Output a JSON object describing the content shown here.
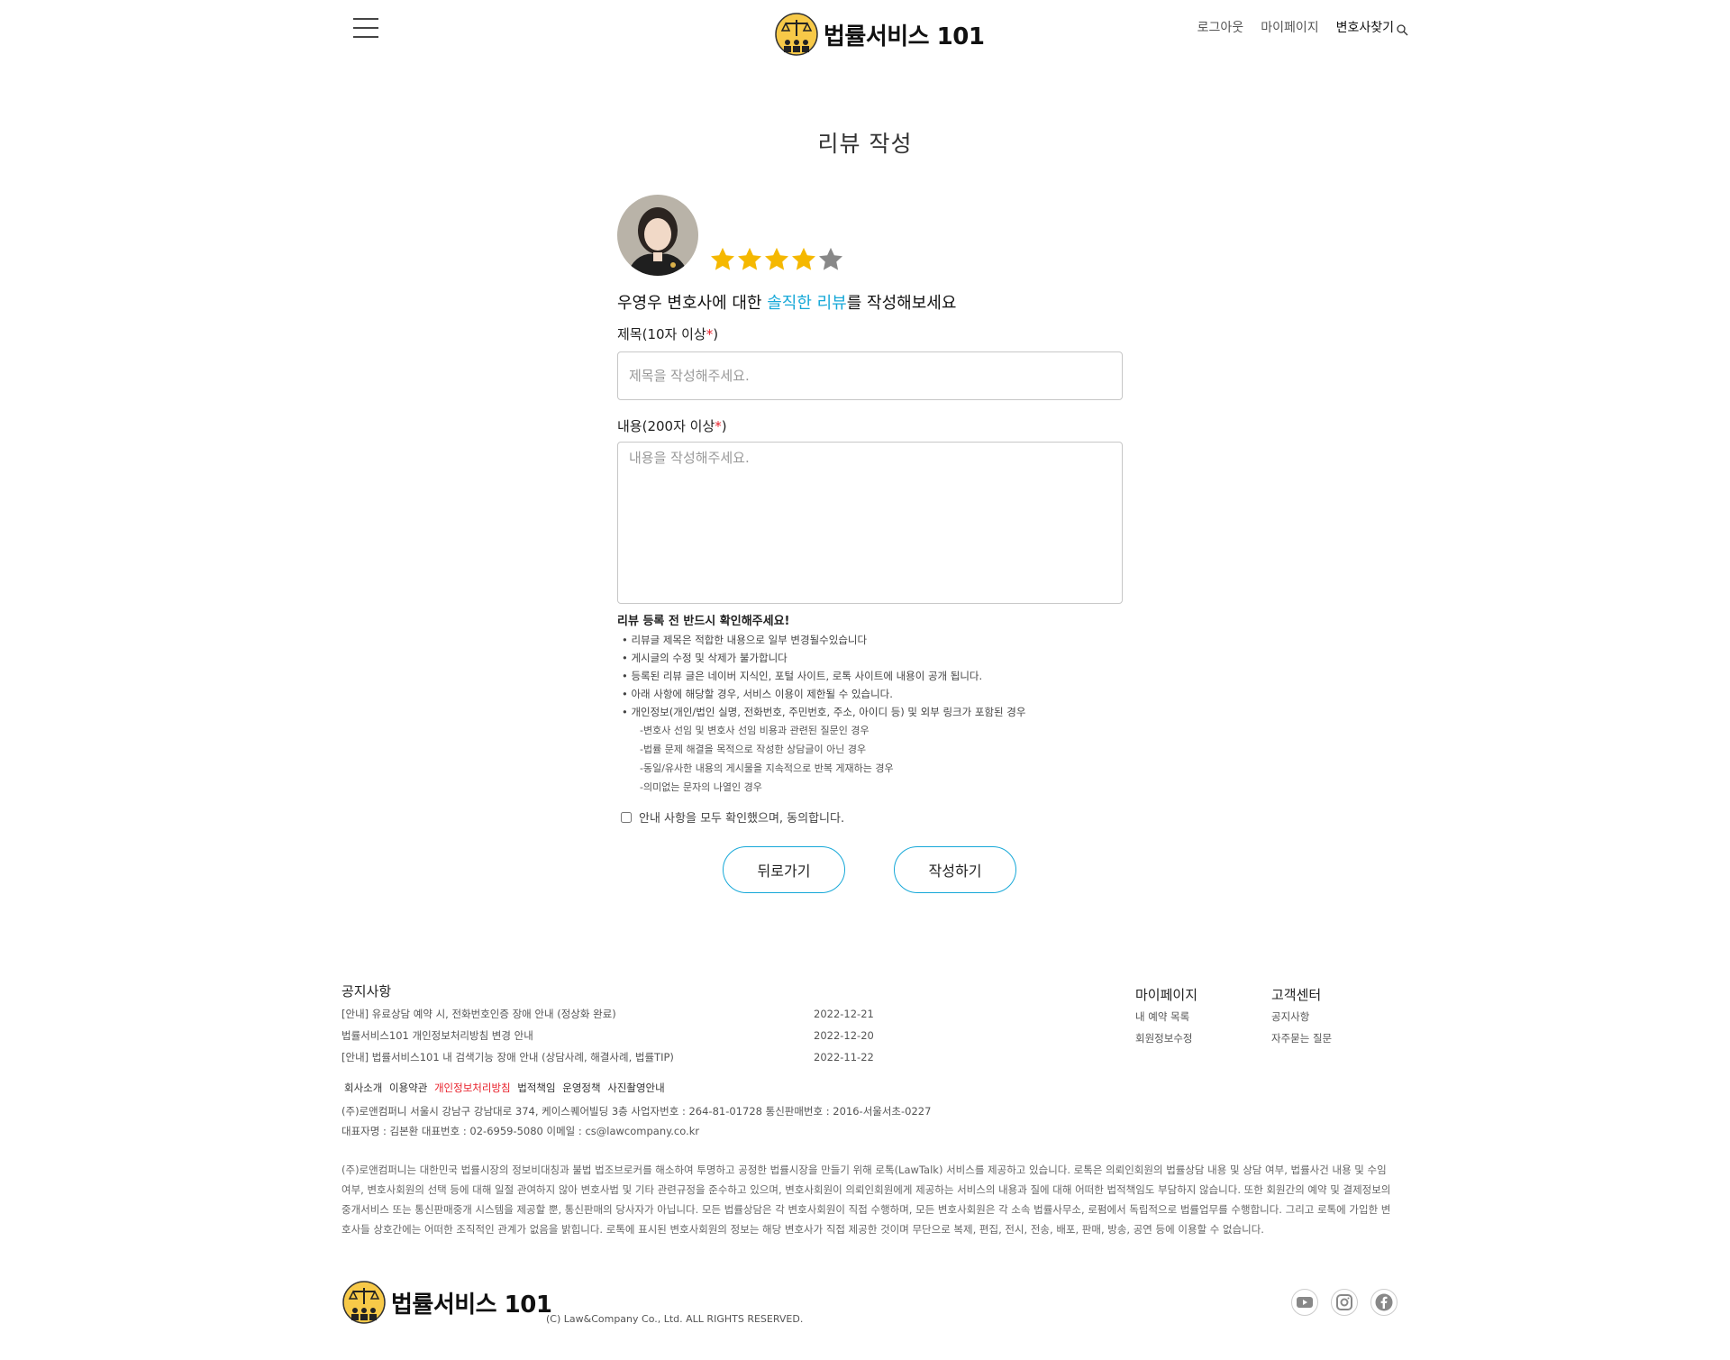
{
  "header": {
    "logo_text": "법률서비스 101",
    "nav": {
      "logout": "로그아웃",
      "mypage": "마이페이지",
      "find_lawyer": "변호사찾기"
    }
  },
  "page": {
    "title": "리뷰 작성"
  },
  "review": {
    "rating": 4,
    "rating_max": 5,
    "cta_pre": "우영우 변호사에 대한 ",
    "cta_highlight": "솔직한 리뷰",
    "cta_post": "를 작성해보세요",
    "title_label": "제목(10자 이상",
    "content_label": "내용(200자 이상",
    "required_mark": "*",
    "closing_paren": ")",
    "title_placeholder": "제목을 작성해주세요.",
    "content_placeholder": "내용을 작성해주세요."
  },
  "notice": {
    "title": "리뷰 등록 전 반드시 확인해주세요!",
    "items": [
      "• 리뷰글 제목은 적합한 내용으로 일부 변경될수있습니다",
      "• 게시글의 수정 및 삭제가 불가합니다",
      "• 등록된 리뷰 글은 네이버 지식인, 포털 사이트, 로톡 사이트에 내용이 공개 됩니다.",
      "• 아래 사항에 해당할 경우, 서비스 이용이 제한될 수 있습니다.",
      "• 개인정보(개인/법인 실명, 전화번호, 주민번호, 주소, 아이디 등) 및 외부 링크가 포함된 경우"
    ],
    "sub_items": [
      "-변호사 선임 및 변호사 선임 비용과 관련된 질문인 경우",
      "-법률 문제 해결을 목적으로 작성한 상담글이 아닌 경우",
      "-동일/유사한 내용의 게시물을 지속적으로 반복 게재하는 경우",
      "-의미없는 문자의 나열인 경우"
    ],
    "agree": "안내 사항을 모두 확인했으며, 동의합니다."
  },
  "buttons": {
    "back": "뒤로가기",
    "submit": "작성하기"
  },
  "footer": {
    "notice_title": "공지사항",
    "notices": [
      {
        "title": "[안내] 유료상담 예약 시, 전화번호인증 장애 안내 (정상화 완료)",
        "date": "2022-12-21"
      },
      {
        "title": "법률서비스101 개인정보처리방침 변경 안내",
        "date": "2022-12-20"
      },
      {
        "title": "[안내] 법률서비스101 내 검색기능 장애 안내 (상담사례, 해결사례, 법률TIP)",
        "date": "2022-11-22"
      }
    ],
    "mypage_title": "마이페이지",
    "mypage_links": [
      "내 예약 목록",
      "회원정보수정"
    ],
    "cs_title": "고객센터",
    "cs_links": [
      "공지사항",
      "자주묻는 질문"
    ],
    "corp_links": [
      "회사소개",
      "이용약관",
      "개인정보처리방침",
      "법적책임",
      "운영정책",
      "사진촬영안내"
    ],
    "corp_info_1": "(주)로앤컴퍼니 서울시 강남구 강남대로 374, 케이스퀘어빌딩 3층 사업자번호 : 264-81-01728 통신판매번호 : 2016-서울서초-0227",
    "corp_info_2": "대표자명 : 김본환 대표번호 : 02-6959-5080 이메일 : cs@lawcompany.co.kr",
    "disclaimer": "(주)로앤컴퍼니는 대한민국 법률시장의 정보비대칭과 불법 법조브로커를 해소하여 투명하고 공정한 법률시장을 만들기 위해 로톡(LawTalk) 서비스를 제공하고 있습니다. 로톡은 의뢰인회원의 법률상담 내용 및 상담 여부, 법률사건 내용 및 수임 여부, 변호사회원의 선택 등에 대해 일절 관여하지 않아 변호사법 및 기타 관련규정을 준수하고 있으며, 변호사회원이 의뢰인회원에게 제공하는 서비스의 내용과 질에 대해 어떠한 법적책임도 부담하지 않습니다. 또한 회원간의 예약 및 결제정보의 중개서비스 또는 통신판매중개 시스템을 제공할 뿐, 통신판매의 당사자가 아닙니다. 모든 법률상담은 각 변호사회원이 직접 수행하며, 모든 변호사회원은 각 소속 법률사무소, 로펌에서 독립적으로 법률업무를 수행합니다. 그리고 로톡에 가입한 변호사들 상호간에는 어떠한 조직적인 관계가 없음을 밝힙니다. 로톡에 표시된 변호사회원의 정보는 해당 변호사가 직접 제공한 것이며 무단으로 복제, 편집, 전시, 전송, 배포, 판매, 방송, 공연 등에 이용할 수 없습니다.",
    "logo_text": "법률서비스 101",
    "copyright": "(C) Law&Company Co., Ltd. ALL RIGHTS RESERVED.",
    "social": [
      "youtube-icon",
      "instagram-icon",
      "facebook-icon"
    ]
  },
  "colors": {
    "accent": "#16a8d8",
    "required": "#e8202a",
    "star_on": "#f5b800",
    "star_off": "#888888"
  }
}
